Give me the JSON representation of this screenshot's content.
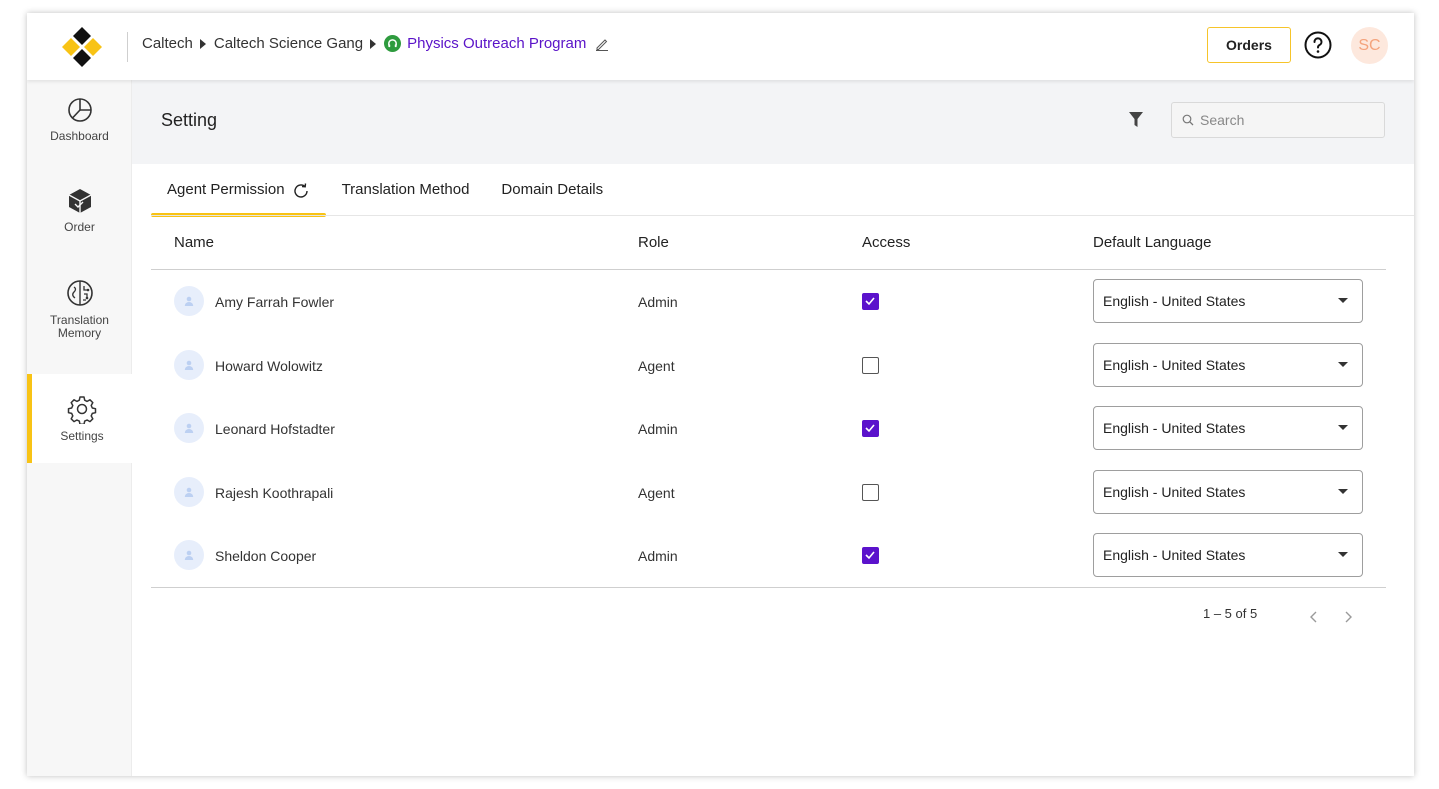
{
  "colors": {
    "accent": "#f8c315",
    "primary": "#5b12cc",
    "program_icon": "#2e9b3e"
  },
  "breadcrumb": {
    "items": [
      "Caltech",
      "Caltech Science Gang"
    ],
    "current": "Physics Outreach Program",
    "current_icon": "headset-icon",
    "edit_icon": "pencil-icon"
  },
  "header": {
    "orders_label": "Orders",
    "help_icon": "help-circle-icon",
    "avatar_initials": "SC"
  },
  "sidebar": {
    "items": [
      {
        "label": "Dashboard",
        "icon": "pie-chart-icon",
        "active": false
      },
      {
        "label": "Order",
        "icon": "box-icon",
        "active": false
      },
      {
        "label": "Translation Memory",
        "icon": "brain-icon",
        "active": false
      },
      {
        "label": "Settings",
        "icon": "gear-icon",
        "active": true
      }
    ]
  },
  "page": {
    "title": "Setting"
  },
  "search": {
    "placeholder": "Search",
    "value": ""
  },
  "tabs": [
    {
      "label": "Agent Permission",
      "active": true
    },
    {
      "label": "Translation Method",
      "active": false
    },
    {
      "label": "Domain Details",
      "active": false
    }
  ],
  "table": {
    "columns": [
      "Name",
      "Role",
      "Access",
      "Default Language"
    ],
    "rows": [
      {
        "name": "Amy Farrah Fowler",
        "role": "Admin",
        "access": true,
        "language": "English - United States"
      },
      {
        "name": "Howard Wolowitz",
        "role": "Agent",
        "access": false,
        "language": "English - United States"
      },
      {
        "name": "Leonard Hofstadter",
        "role": "Admin",
        "access": true,
        "language": "English - United States"
      },
      {
        "name": "Rajesh Koothrapali",
        "role": "Agent",
        "access": false,
        "language": "English - United States"
      },
      {
        "name": "Sheldon Cooper",
        "role": "Admin",
        "access": true,
        "language": "English - United States"
      }
    ]
  },
  "pagination": {
    "range": "1 – 5 of 5"
  }
}
